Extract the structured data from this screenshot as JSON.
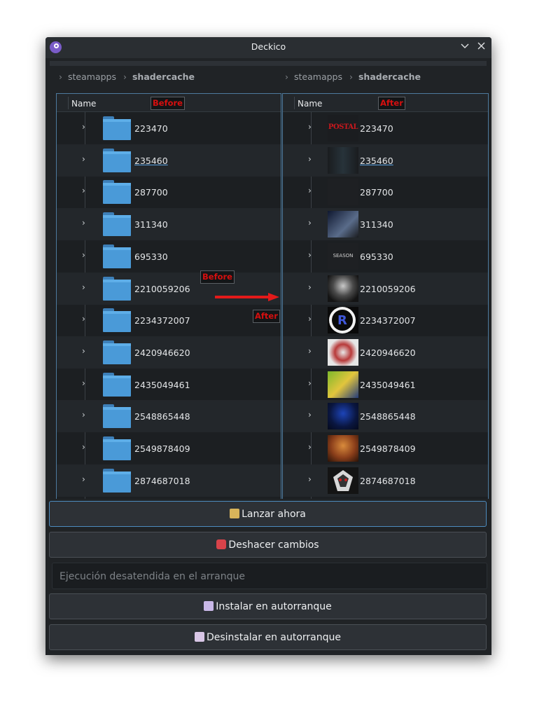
{
  "window": {
    "title": "Deckico"
  },
  "left_panel": {
    "breadcrumb": {
      "parent": "steamapps",
      "current": "shadercache"
    },
    "column_header": "Name",
    "tag": "Before",
    "rows": [
      "223470",
      "235460",
      "287700",
      "311340",
      "695330",
      "2210059206",
      "2234372007",
      "2420946620",
      "2435049461",
      "2548865448",
      "2549878409",
      "2874687018"
    ]
  },
  "right_panel": {
    "breadcrumb": {
      "parent": "steamapps",
      "current": "shadercache"
    },
    "column_header": "Name",
    "tag": "After",
    "rows": [
      {
        "label": "223470",
        "icon": "postal-logo-icon"
      },
      {
        "label": "235460",
        "icon": "game-logo-icon"
      },
      {
        "label": "287700",
        "icon": "game-logo-icon"
      },
      {
        "label": "311340",
        "icon": "game-banner-icon"
      },
      {
        "label": "695330",
        "icon": "season-logo-icon"
      },
      {
        "label": "2210059206",
        "icon": "game-art-icon"
      },
      {
        "label": "2234372007",
        "icon": "r-logo-icon"
      },
      {
        "label": "2420946620",
        "icon": "game-art-icon"
      },
      {
        "label": "2435049461",
        "icon": "game-logo-icon"
      },
      {
        "label": "2548865448",
        "icon": "game-art-icon"
      },
      {
        "label": "2549878409",
        "icon": "game-art-icon"
      },
      {
        "label": "2874687018",
        "icon": "wolf-logo-icon"
      }
    ]
  },
  "annotations": {
    "before_label": "Before",
    "after_label": "After",
    "postal_text": "POSTAL",
    "season_text": "SEASON"
  },
  "buttons": {
    "launch": "Lanzar ahora",
    "undo": "Deshacer cambios",
    "install": "Instalar en autorranque",
    "uninstall": "Desinstalar en autorranque"
  },
  "unattended_field": {
    "placeholder": "Ejecución desatendida en el arranque"
  },
  "colors": {
    "accent": "#4d8cbf",
    "tag_text": "#d60f0f",
    "arrow": "#e31a1a",
    "folder": "#4a9ad8"
  }
}
